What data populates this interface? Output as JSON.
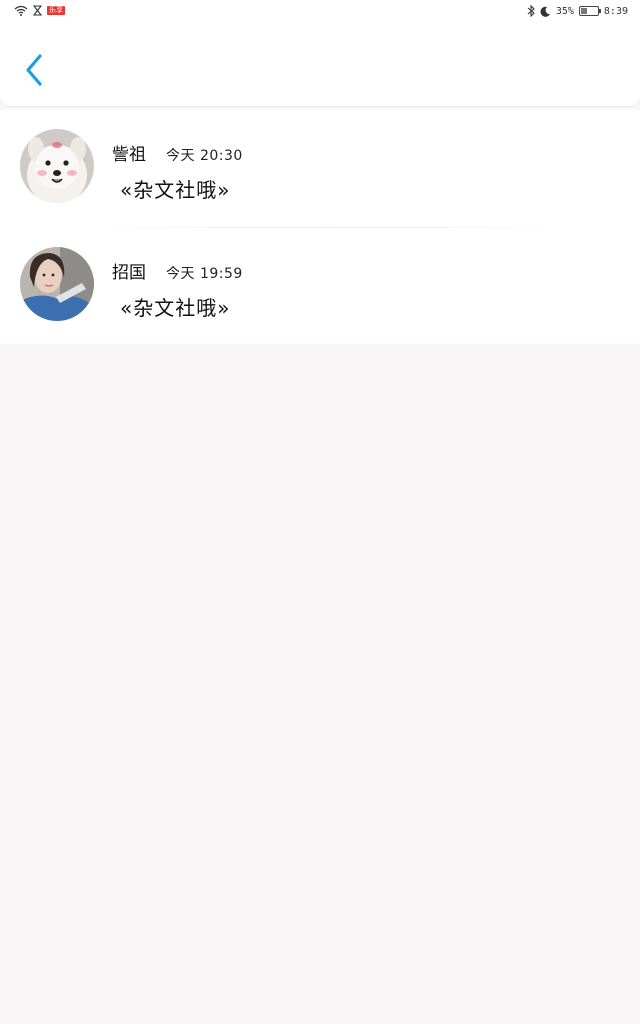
{
  "status_bar": {
    "badge": "乐享",
    "battery": "35%",
    "battery_level": 0.35,
    "time": "8:39"
  },
  "header": {
    "back_icon": "chevron-left-icon",
    "accent_color": "#1a9ee6"
  },
  "messages": [
    {
      "username": "訾祖",
      "time": "今天 20:30",
      "content": "«杂文社哦»",
      "avatar": "samoyed-dog-avatar"
    },
    {
      "username": "招国",
      "time": "今天 19:59",
      "content": "«杂文社哦»",
      "avatar": "girl-portrait-avatar"
    }
  ]
}
